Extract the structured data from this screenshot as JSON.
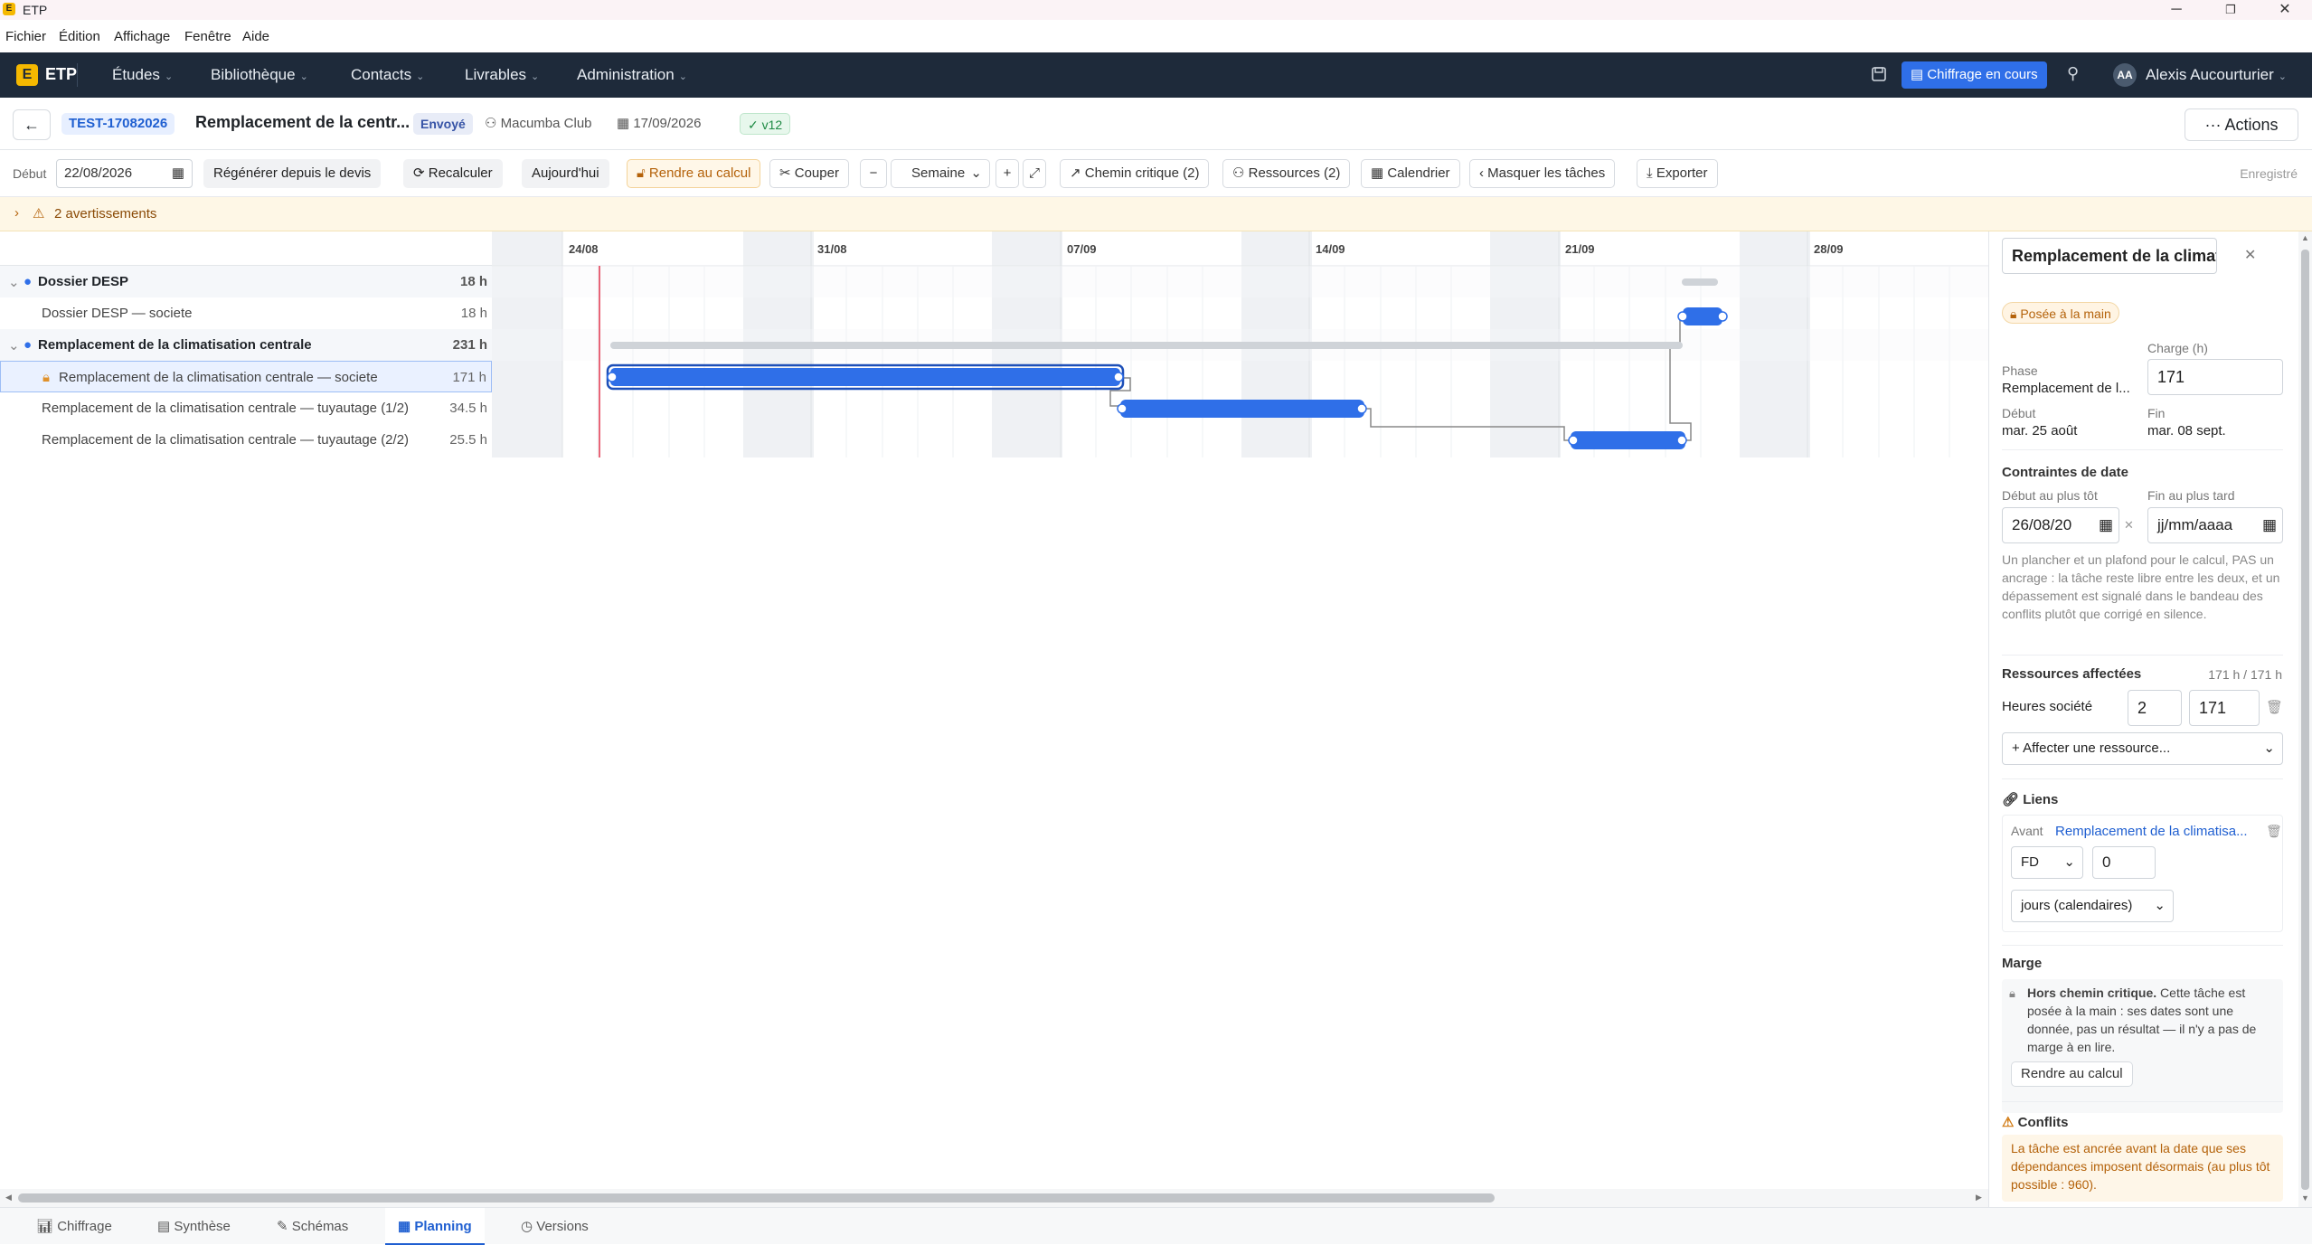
{
  "window": {
    "title": "ETP",
    "logo_letter": "E"
  },
  "menubar": [
    "Fichier",
    "Édition",
    "Affichage",
    "Fenêtre",
    "Aide"
  ],
  "nav": {
    "brand": "ETP",
    "items": [
      "Études",
      "Bibliothèque",
      "Contacts",
      "Livrables",
      "Administration"
    ],
    "status_button": "Chiffrage en cours",
    "user_initials": "AA",
    "user_name": "Alexis Aucourturier"
  },
  "header": {
    "back": "←",
    "ref": "TEST-17082026",
    "title": "Remplacement de la centr...",
    "status": "Envoyé",
    "client": "Macumba Club",
    "date": "17/09/2026",
    "version": "v12",
    "actions": "Actions"
  },
  "toolbar": {
    "start_label": "Début",
    "start_value": "22/08/2026",
    "regen": "Régénérer depuis le devis",
    "recalc": "Recalculer",
    "today": "Aujourd'hui",
    "return_calc": "Rendre au calcul",
    "cut": "Couper",
    "zoom_minus": "−",
    "scale": "Semaine",
    "zoom_plus": "+",
    "critical": "Chemin critique (2)",
    "resources": "Ressources (2)",
    "calendar": "Calendrier",
    "hide_tasks": "Masquer les tâches",
    "export": "Exporter",
    "saved": "Enregistré"
  },
  "warnings": {
    "label": "2 avertissements"
  },
  "gantt": {
    "weeks": [
      "24/08",
      "31/08",
      "07/09",
      "14/09",
      "21/09",
      "28/09"
    ],
    "rows": [
      {
        "label": "Dossier DESP",
        "hours": "18 h",
        "group": true
      },
      {
        "label": "Dossier DESP — societe",
        "hours": "18 h",
        "group": false
      },
      {
        "label": "Remplacement de la climatisation centrale",
        "hours": "231 h",
        "group": true
      },
      {
        "label": "Remplacement de la climatisation centrale — societe",
        "hours": "171 h",
        "group": false,
        "selected": true
      },
      {
        "label": "Remplacement de la climatisation centrale — tuyautage (1/2)",
        "hours": "34.5 h",
        "group": false
      },
      {
        "label": "Remplacement de la climatisation centrale — tuyautage (2/2)",
        "hours": "25.5 h",
        "group": false
      }
    ]
  },
  "panel": {
    "task_title": "Remplacement de la climatisati",
    "close": "✕",
    "manual_badge": "Posée à la main",
    "phase_label": "Phase",
    "phase_value": "Remplacement de l...",
    "charge_label": "Charge (h)",
    "charge_value": "171",
    "start_label": "Début",
    "start_value": "mar. 25 août",
    "end_label": "Fin",
    "end_value": "mar. 08 sept.",
    "constraints_title": "Contraintes de date",
    "earliest_label": "Début au plus tôt",
    "earliest_value": "26/08/20",
    "latest_label": "Fin au plus tard",
    "latest_value": "jj/mm/aaaa",
    "clear": "✕",
    "constraints_help": "Un plancher et un plafond pour le calcul, PAS un ancrage : la tâche reste libre entre les deux, et un dépassement est signalé dans le bandeau des conflits plutôt que corrigé en silence.",
    "resources_title": "Ressources affectées",
    "resources_total": "171 h / 171 h",
    "resource_name": "Heures société",
    "resource_qty": "2",
    "resource_hours": "171",
    "assign_resource": "+ Affecter une ressource...",
    "links_title": "Liens",
    "link_before": "Avant",
    "link_target": "Remplacement de la climatisa...",
    "link_type": "FD",
    "link_lag": "0",
    "link_unit": "jours (calendaires)",
    "margin_title": "Marge",
    "margin_strong": "Hors chemin critique.",
    "margin_text": "Cette tâche est posée à la main : ses dates sont une donnée, pas un résultat — il n'y a pas de marge à en lire.",
    "margin_button": "Rendre au calcul",
    "conflicts_title": "Conflits",
    "conflicts_text": "La tâche est ancrée avant la date que ses dépendances imposent désormais (au plus tôt possible : 960)."
  },
  "tabs": [
    "Chiffrage",
    "Synthèse",
    "Schémas",
    "Planning",
    "Versions"
  ],
  "colors": {
    "accent": "#2f6fe8",
    "nav_bg": "#1e2a3a",
    "warn": "#b4620a",
    "today_line": "#e0334c"
  }
}
